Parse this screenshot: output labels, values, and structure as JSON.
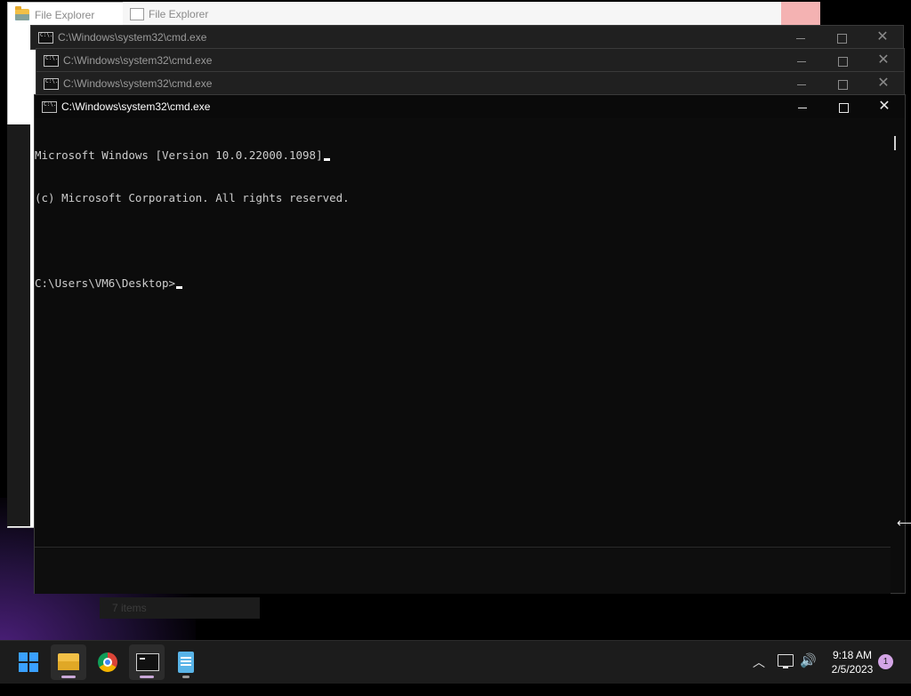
{
  "file_explorer": {
    "window1_title": "File Explorer",
    "window2_title": "File Explorer",
    "status_text": "7 items"
  },
  "cmd_windows": {
    "back_titles": [
      "C:\\Windows\\system32\\cmd.exe",
      "C:\\Windows\\system32\\cmd.exe",
      "C:\\Windows\\system32\\cmd.exe"
    ],
    "front_title": "C:\\Windows\\system32\\cmd.exe"
  },
  "console": {
    "lines": [
      "Microsoft Windows [Version 10.0.22000.1098]",
      "(c) Microsoft Corporation. All rights reserved.",
      "",
      "C:\\Users\\VM6\\Desktop>"
    ]
  },
  "taskbar": {
    "items": [
      "windows-start",
      "file-explorer",
      "chrome",
      "command-prompt",
      "notepad"
    ],
    "clock_time": "9:18 AM",
    "clock_date": "2/5/2023",
    "notification_count": "1",
    "tray_icons": [
      "chevron-up-icon",
      "network-icon",
      "volume-icon"
    ]
  },
  "colors": {
    "console_bg": "#0c0c0c",
    "console_text": "#cccccc",
    "taskbar_bg": "#1c1c1c",
    "accent_badge": "#d4a5e6"
  }
}
